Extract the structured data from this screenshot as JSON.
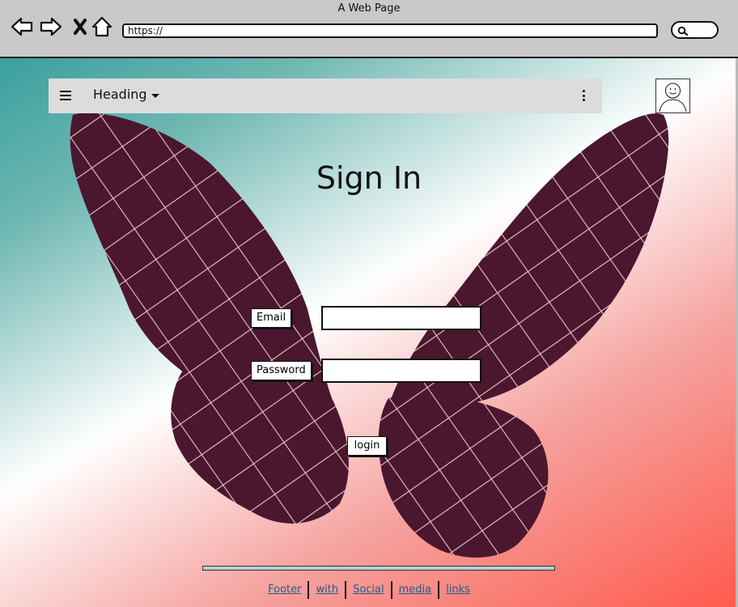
{
  "browser": {
    "window_title": "A Web Page",
    "url": "https://",
    "icons": [
      "back-arrow-icon",
      "forward-arrow-icon",
      "close-x-icon",
      "home-icon",
      "search-icon"
    ]
  },
  "appbar": {
    "heading": "Heading",
    "icons": [
      "hamburger-menu-icon",
      "dropdown-caret-icon",
      "more-vertical-icon",
      "user-avatar-icon"
    ]
  },
  "form": {
    "title": "Sign In",
    "email_label": "Email",
    "email_value": "",
    "password_label": "Password",
    "password_value": "",
    "login_label": "login"
  },
  "footer": {
    "links": [
      "Footer",
      "with",
      "Social",
      "media",
      "links"
    ]
  },
  "colors": {
    "gradient_teal": "#3aa09e",
    "gradient_coral": "#ff5a4c",
    "butterfly": "#4a172e",
    "appbar_bg": "#dcdcdc",
    "link": "#1f5d8e"
  }
}
